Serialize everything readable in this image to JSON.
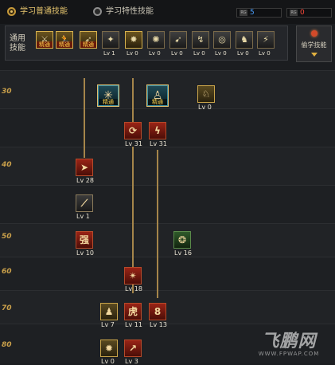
{
  "tabs": [
    {
      "label": "学习普通技能",
      "selected": true
    },
    {
      "label": "学习特性技能",
      "selected": false
    }
  ],
  "points": [
    {
      "tag": "RG",
      "value": "5",
      "color": "#4aa0ff"
    },
    {
      "tag": "RG",
      "value": "0",
      "color": "#ff4a3a"
    }
  ],
  "common": {
    "label": "通用技能",
    "skills": [
      {
        "icon": "swordsman-icon",
        "glyph": "⚔",
        "caption": "精通",
        "level": ""
      },
      {
        "icon": "runner-icon",
        "glyph": "🏃",
        "caption": "精通",
        "level": ""
      },
      {
        "icon": "leap-icon",
        "glyph": "➶",
        "caption": "精通",
        "level": ""
      },
      {
        "icon": "wings-icon",
        "glyph": "✦",
        "caption": "",
        "level": "Lv 1"
      },
      {
        "icon": "star-burst-icon",
        "glyph": "✸",
        "caption": "",
        "level": "Lv 0"
      },
      {
        "icon": "green-orb-icon",
        "glyph": "✺",
        "caption": "",
        "level": "Lv 0"
      },
      {
        "icon": "dash-icon",
        "glyph": "➹",
        "caption": "",
        "level": "Lv 0"
      },
      {
        "icon": "kick-icon",
        "glyph": "↯",
        "caption": "",
        "level": "Lv 0"
      },
      {
        "icon": "target-icon",
        "glyph": "◎",
        "caption": "",
        "level": "Lv 0"
      },
      {
        "icon": "fighter-icon",
        "glyph": "♞",
        "caption": "",
        "level": "Lv 0"
      },
      {
        "icon": "strike-icon",
        "glyph": "⚡",
        "caption": "",
        "level": "Lv 0"
      }
    ]
  },
  "steal": {
    "label": "偷学技能"
  },
  "levels": [
    "30",
    "40",
    "50",
    "60",
    "70",
    "80"
  ],
  "tree": [
    {
      "icon": "frost-burst-icon",
      "glyph": "✳",
      "caption": "精通",
      "level": ""
    },
    {
      "icon": "aura-figure-icon",
      "glyph": "♙",
      "caption": "精通",
      "level": ""
    },
    {
      "icon": "dragon-head-icon",
      "glyph": "♘",
      "caption": "",
      "level": "Lv 0"
    },
    {
      "icon": "tiger-claw-icon",
      "glyph": "⟳",
      "caption": "",
      "level": "Lv 31"
    },
    {
      "icon": "spiral-fist-icon",
      "glyph": "ϟ",
      "caption": "",
      "level": "Lv 31"
    },
    {
      "icon": "dash-strike-icon",
      "glyph": "➤",
      "caption": "",
      "level": "Lv 28"
    },
    {
      "icon": "slash-icon",
      "glyph": "⟋",
      "caption": "",
      "level": "Lv 1"
    },
    {
      "icon": "strong-char-icon",
      "glyph": "强",
      "caption": "",
      "level": "Lv 10"
    },
    {
      "icon": "green-spirit-icon",
      "glyph": "❂",
      "caption": "",
      "level": "Lv 16"
    },
    {
      "icon": "fan-blade-icon",
      "glyph": "✴",
      "caption": "",
      "level": "Lv 18"
    },
    {
      "icon": "warrior-icon",
      "glyph": "♟",
      "caption": "",
      "level": "Lv 7"
    },
    {
      "icon": "tiger-char-icon",
      "glyph": "虎",
      "caption": "",
      "level": "Lv 11"
    },
    {
      "icon": "ring-icon",
      "glyph": "8",
      "caption": "",
      "level": "Lv 13"
    },
    {
      "icon": "burst-icon",
      "glyph": "✹",
      "caption": "",
      "level": "Lv 0"
    },
    {
      "icon": "uppercut-icon",
      "glyph": "↗",
      "caption": "",
      "level": "Lv 3"
    }
  ],
  "watermark": {
    "text": "飞鹏网",
    "url": "WWW.FPWAP.COM"
  }
}
